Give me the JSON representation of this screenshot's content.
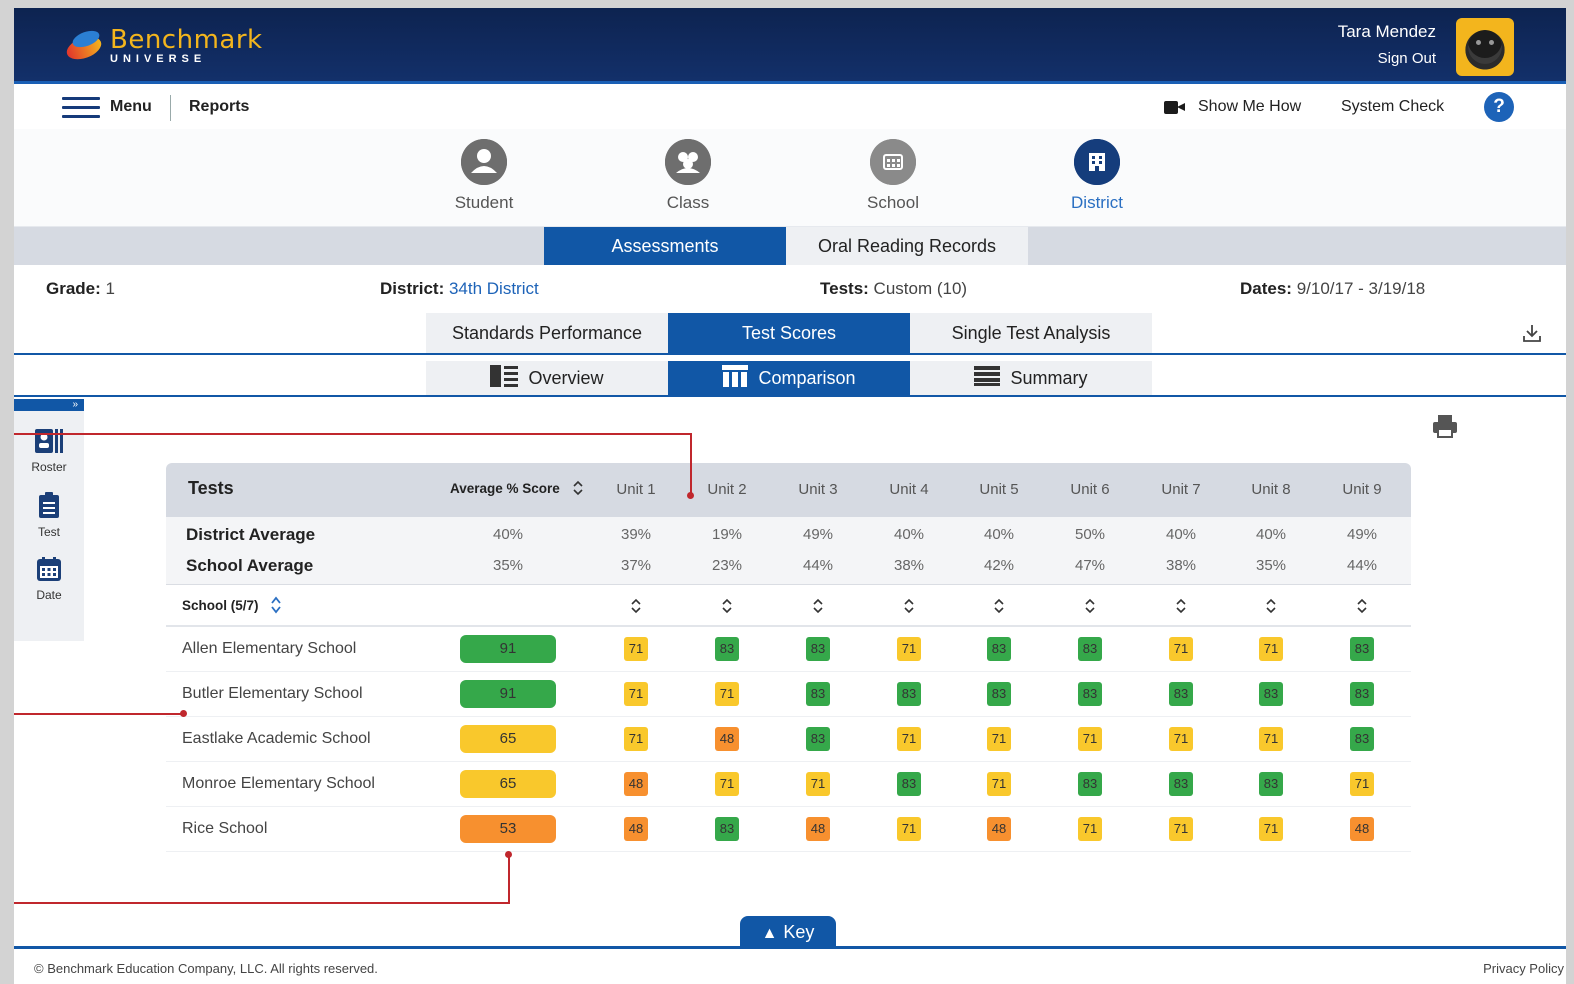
{
  "app": {
    "logo_title": "Benchmark",
    "logo_subtitle": "UNIVERSE"
  },
  "user": {
    "name": "Tara Mendez",
    "sign_out": "Sign Out"
  },
  "menubar": {
    "menu_label": "Menu",
    "section": "Reports",
    "show_me_how": "Show Me How",
    "system_check": "System Check",
    "help": "?"
  },
  "levels": [
    {
      "label": "Student",
      "icon": "student-icon",
      "active": false
    },
    {
      "label": "Class",
      "icon": "class-icon",
      "active": false
    },
    {
      "label": "School",
      "icon": "school-icon",
      "active": false
    },
    {
      "label": "District",
      "icon": "district-icon",
      "active": true
    }
  ],
  "assessment_tabs": [
    {
      "label": "Assessments",
      "active": true
    },
    {
      "label": "Oral Reading Records",
      "active": false
    }
  ],
  "filters": {
    "grade_label": "Grade:",
    "grade_value": "1",
    "district_label": "District:",
    "district_value": "34th District",
    "tests_label": "Tests:",
    "tests_value": "Custom (10)",
    "dates_label": "Dates:",
    "dates_value": "9/10/17 - 3/19/18"
  },
  "report_tabs": [
    {
      "label": "Standards Performance",
      "active": false
    },
    {
      "label": "Test Scores",
      "active": true
    },
    {
      "label": "Single Test Analysis",
      "active": false
    }
  ],
  "view_tabs": [
    {
      "label": "Overview",
      "active": false,
      "icon": "overview-icon"
    },
    {
      "label": "Comparison",
      "active": true,
      "icon": "comparison-icon"
    },
    {
      "label": "Summary",
      "active": false,
      "icon": "summary-icon"
    }
  ],
  "sidebar": {
    "expander": "»",
    "items": [
      {
        "label": "Roster",
        "icon": "roster-icon"
      },
      {
        "label": "Test",
        "icon": "test-clipboard-icon"
      },
      {
        "label": "Date",
        "icon": "calendar-icon"
      }
    ]
  },
  "table": {
    "tests_header": "Tests",
    "avg_header": "Average % Score",
    "units": [
      "Unit 1",
      "Unit 2",
      "Unit 3",
      "Unit 4",
      "Unit 5",
      "Unit 6",
      "Unit 7",
      "Unit 8",
      "Unit 9"
    ],
    "averages": [
      {
        "name": "District Average",
        "overall": "40%",
        "values": [
          "39%",
          "19%",
          "49%",
          "40%",
          "40%",
          "50%",
          "40%",
          "40%",
          "49%"
        ]
      },
      {
        "name": "School Average",
        "overall": "35%",
        "values": [
          "37%",
          "23%",
          "44%",
          "38%",
          "42%",
          "47%",
          "38%",
          "35%",
          "44%"
        ]
      }
    ],
    "school_filter": "School (5/7)",
    "rows": [
      {
        "name": "Allen Elementary School",
        "avg": 91,
        "scores": [
          71,
          83,
          83,
          71,
          83,
          83,
          71,
          71,
          83
        ]
      },
      {
        "name": "Butler Elementary School",
        "avg": 91,
        "scores": [
          71,
          71,
          83,
          83,
          83,
          83,
          83,
          83,
          83
        ]
      },
      {
        "name": "Eastlake Academic School",
        "avg": 65,
        "scores": [
          71,
          48,
          83,
          71,
          71,
          71,
          71,
          71,
          83
        ]
      },
      {
        "name": "Monroe Elementary School",
        "avg": 65,
        "scores": [
          48,
          71,
          71,
          83,
          71,
          83,
          83,
          83,
          71
        ]
      },
      {
        "name": "Rice School",
        "avg": 53,
        "scores": [
          48,
          83,
          48,
          71,
          48,
          71,
          71,
          71,
          48
        ]
      }
    ]
  },
  "colors": {
    "green": "#35a84a",
    "yellow": "#f9c82c",
    "orange": "#f7902f",
    "primary": "#1157a6",
    "annotation": "#c0272d"
  },
  "key_label": "Key",
  "footer": {
    "copyright": "© Benchmark Education Company, LLC. All rights reserved.",
    "privacy": "Privacy Policy"
  }
}
